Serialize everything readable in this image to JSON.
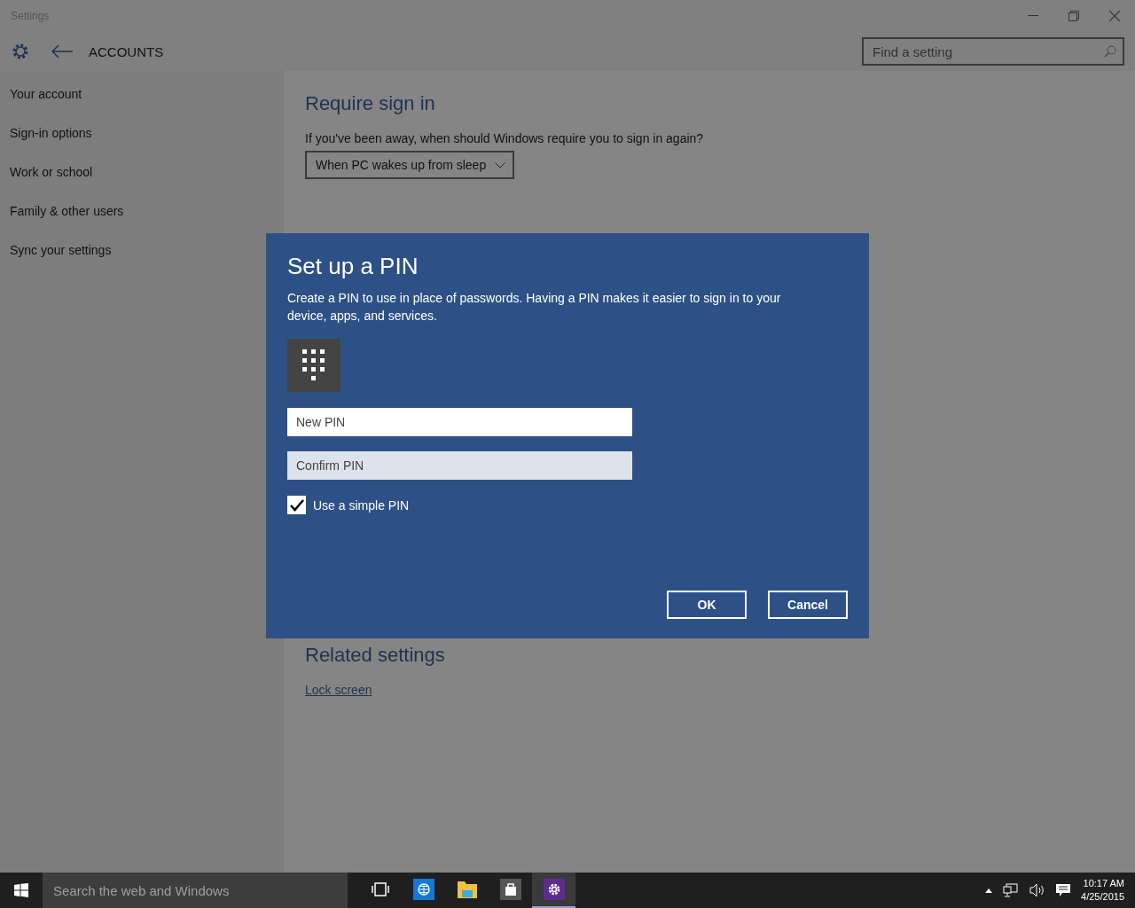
{
  "window": {
    "title": "Settings"
  },
  "header": {
    "title": "ACCOUNTS",
    "search": {
      "placeholder": "Find a setting"
    }
  },
  "sidebar": {
    "items": [
      {
        "label": "Your account"
      },
      {
        "label": "Sign-in options"
      },
      {
        "label": "Work or school"
      },
      {
        "label": "Family & other users"
      },
      {
        "label": "Sync your settings"
      }
    ]
  },
  "require_sign_in": {
    "heading": "Require sign in",
    "prompt": "If you've been away, when should Windows require you to sign in again?",
    "dropdown": {
      "value": "When PC wakes up from sleep"
    }
  },
  "related_settings": {
    "heading": "Related settings",
    "link": "Lock screen"
  },
  "dialog": {
    "title": "Set up a PIN",
    "description": "Create a PIN to use in place of passwords. Having a PIN makes it easier to sign in to your device, apps, and services.",
    "fields": [
      {
        "placeholder": "New PIN",
        "focused": true
      },
      {
        "placeholder": "Confirm PIN",
        "focused": false
      }
    ],
    "checkbox": {
      "label": "Use a simple PIN",
      "checked": true
    },
    "buttons": [
      "OK",
      "Cancel"
    ]
  },
  "taskbar": {
    "search": {
      "placeholder": "Search the web and Windows"
    },
    "apps": [
      {
        "kind": "taskview",
        "selected": false
      },
      {
        "kind": "browser",
        "selected": false
      },
      {
        "kind": "folder",
        "selected": false
      },
      {
        "kind": "store",
        "selected": false
      },
      {
        "kind": "settings",
        "selected": true
      }
    ],
    "time": "10:17 AM",
    "date": "4/25/2015"
  }
}
